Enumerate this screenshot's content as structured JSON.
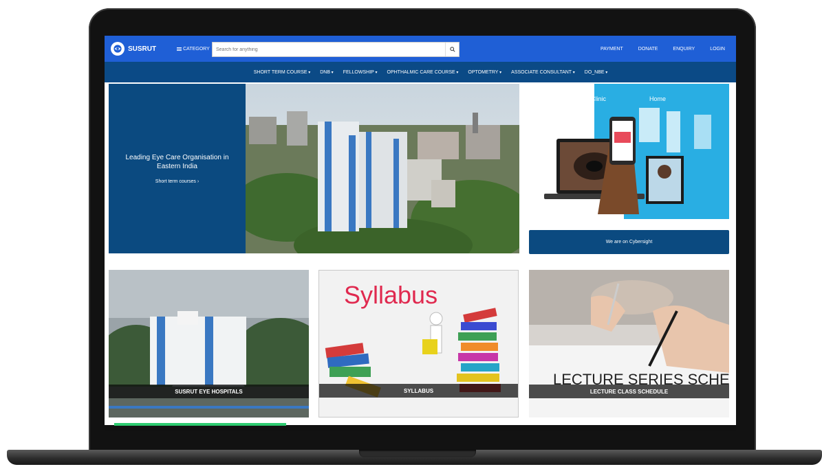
{
  "brand": {
    "name": "SUSRUT"
  },
  "topbar": {
    "category_label": "CATEGORY",
    "search_placeholder": "Search for anything",
    "links": [
      "PAYMENT",
      "DONATE",
      "ENQUIRY",
      "LOGIN"
    ]
  },
  "nav": {
    "items": [
      "SHORT TERM COURSE",
      "DNB",
      "FELLOWSHIP",
      "OPHTHALMIC CARE COURSE",
      "OPTOMETRY",
      "ASSOCIATE CONSULTANT",
      "DO_NBE"
    ]
  },
  "hero": {
    "title": "Leading Eye Care Organisation in Eastern India",
    "link": "Short term courses"
  },
  "promo": {
    "image_text": [
      "Clinic",
      "Home"
    ],
    "button_label": "We are on Cybersight"
  },
  "cards": [
    {
      "label": "SUSRUT EYE HOSPITALS"
    },
    {
      "label": "SYLLABUS",
      "image_title": "Syllabus"
    },
    {
      "label": "LECTURE CLASS SCHEDULE",
      "image_text": "LECTURE SERIES SCHEDULE"
    }
  ],
  "colors": {
    "topbar": "#1f5fd6",
    "navbar": "#0b4a86",
    "hero_panel": "#0b4a80",
    "promo_bg": "#29aee3",
    "syllabus_text": "#e0294f"
  },
  "icons": [
    "logo-icon",
    "menu-icon",
    "search-icon",
    "chevron-right-icon"
  ]
}
